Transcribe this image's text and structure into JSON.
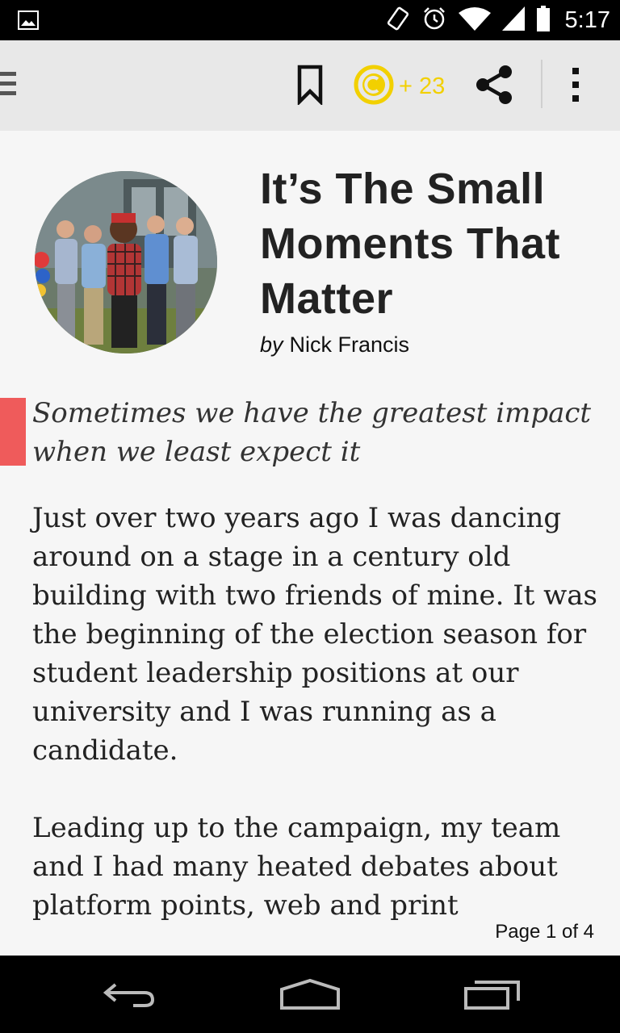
{
  "status_bar": {
    "time": "5:17",
    "icons": [
      "image-notification-icon",
      "rotate-icon",
      "alarm-icon",
      "wifi-icon",
      "signal-icon",
      "battery-icon"
    ]
  },
  "toolbar": {
    "menu_icon": "hamburger-icon",
    "bookmark_icon": "bookmark-icon",
    "coin_icon": "coin-icon",
    "coin_bonus": "+ 23",
    "coin_color": "#f2d000",
    "share_icon": "share-icon",
    "overflow_icon": "more-vertical-icon"
  },
  "article": {
    "title": "It’s The Small Moments That Matter",
    "by_label": "by",
    "author": "Nick Francis",
    "subtitle": "Sometimes we have the greatest impact when we least expect it",
    "accent_color": "#ef5b5b",
    "paragraphs": [
      "Just over two years ago I was dancing around on a stage in a century old building with two friends of mine. It was the beginning of the election season for student leadership positions at our university and I was running as a candidate.",
      "Leading up to the campaign, my team and I had many heated debates about platform points, web and print"
    ],
    "page_indicator": "Page 1 of 4"
  },
  "nav_bar": {
    "back_icon": "back-icon",
    "home_icon": "home-icon",
    "recents_icon": "recents-icon"
  }
}
